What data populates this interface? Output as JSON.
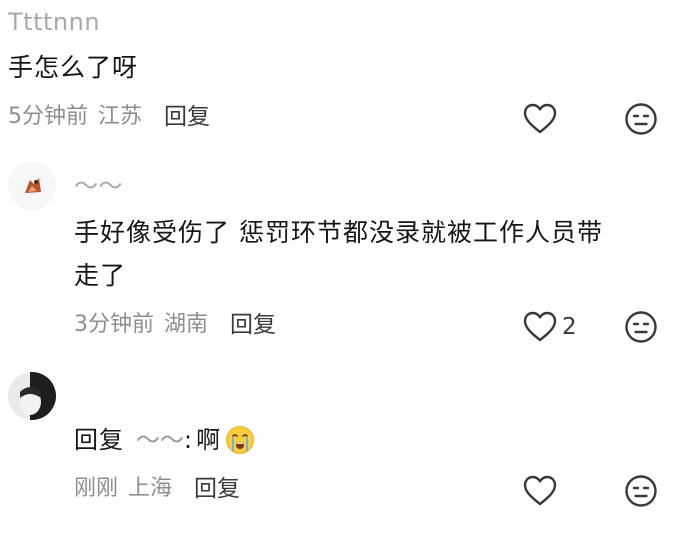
{
  "comments": [
    {
      "username": "Ttttnnn",
      "text": "手怎么了呀",
      "time": "5分钟前",
      "location": "江苏",
      "reply_label": "回复",
      "like_count": "",
      "like_icon": "heart-outline-icon",
      "dislike_icon": "meh-face-icon"
    },
    {
      "username": "～～",
      "text_line1": "手好像受伤了 惩罚环节都没录就被工作人员带",
      "text_line2": "走了",
      "time": "3分钟前",
      "location": "湖南",
      "reply_label": "回复",
      "like_count": "2",
      "like_icon": "heart-outline-icon",
      "dislike_icon": "meh-face-icon"
    },
    {
      "reply_prefix": "回复",
      "reply_target": "～～",
      "reply_colon": ":",
      "reply_body": "啊",
      "emoji": "crying-face-emoji",
      "time": "刚刚",
      "location": "上海",
      "reply_label": "回复",
      "like_count": "",
      "like_icon": "heart-outline-icon",
      "dislike_icon": "meh-face-icon"
    }
  ],
  "colors": {
    "username": "#a9a9a9",
    "text": "#161616",
    "meta": "#8e8e8e",
    "icon": "#3a3a3a"
  }
}
